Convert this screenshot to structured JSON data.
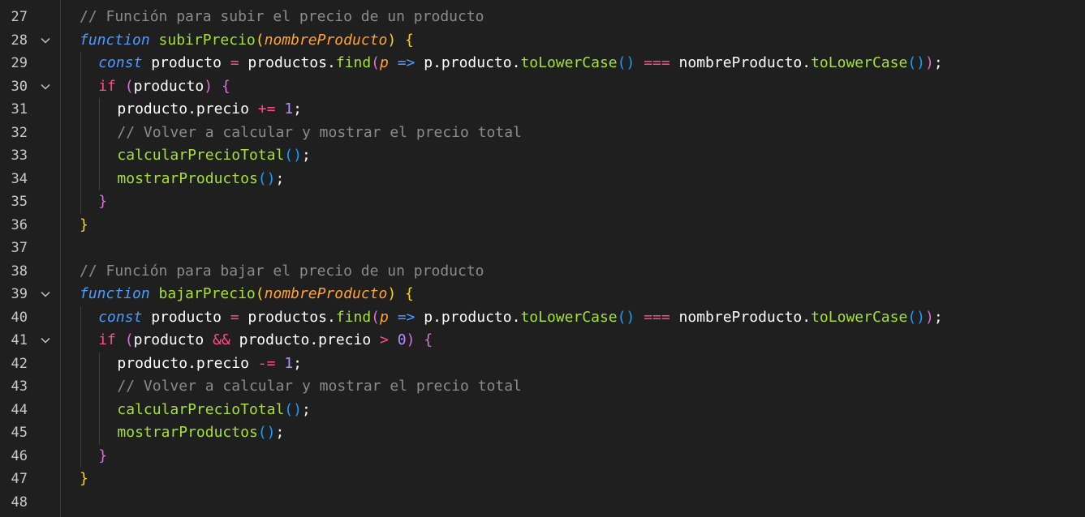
{
  "editor": {
    "lines": [
      {
        "n": "27",
        "fold": false,
        "indent": 0,
        "tokens": [
          {
            "t": "// Función para subir el precio de un producto",
            "c": "t-comment"
          }
        ]
      },
      {
        "n": "28",
        "fold": true,
        "indent": 0,
        "tokens": [
          {
            "t": "function",
            "c": "t-kw-fn"
          },
          {
            "t": " ",
            "c": "t-ident"
          },
          {
            "t": "subirPrecio",
            "c": "t-fnname"
          },
          {
            "t": "(",
            "c": "t-paren-y"
          },
          {
            "t": "nombreProducto",
            "c": "t-param"
          },
          {
            "t": ")",
            "c": "t-paren-y"
          },
          {
            "t": " ",
            "c": "t-ident"
          },
          {
            "t": "{",
            "c": "t-paren-y"
          }
        ]
      },
      {
        "n": "29",
        "fold": false,
        "indent": 1,
        "tokens": [
          {
            "t": "const",
            "c": "t-kw"
          },
          {
            "t": " producto ",
            "c": "t-ident"
          },
          {
            "t": "=",
            "c": "t-op"
          },
          {
            "t": " productos.",
            "c": "t-ident"
          },
          {
            "t": "find",
            "c": "t-method"
          },
          {
            "t": "(",
            "c": "t-paren-p"
          },
          {
            "t": "p",
            "c": "t-param"
          },
          {
            "t": " ",
            "c": "t-ident"
          },
          {
            "t": "=>",
            "c": "t-arrow"
          },
          {
            "t": " p.producto.",
            "c": "t-ident"
          },
          {
            "t": "toLowerCase",
            "c": "t-method"
          },
          {
            "t": "()",
            "c": "t-paren-b"
          },
          {
            "t": " ",
            "c": "t-ident"
          },
          {
            "t": "===",
            "c": "t-op"
          },
          {
            "t": " nombreProducto.",
            "c": "t-ident"
          },
          {
            "t": "toLowerCase",
            "c": "t-method"
          },
          {
            "t": "()",
            "c": "t-paren-b"
          },
          {
            "t": ")",
            "c": "t-paren-p"
          },
          {
            "t": ";",
            "c": "t-ident"
          }
        ]
      },
      {
        "n": "30",
        "fold": true,
        "indent": 1,
        "tokens": [
          {
            "t": "if",
            "c": "t-ctrl"
          },
          {
            "t": " ",
            "c": "t-ident"
          },
          {
            "t": "(",
            "c": "t-paren-p"
          },
          {
            "t": "producto",
            "c": "t-ident"
          },
          {
            "t": ")",
            "c": "t-paren-p"
          },
          {
            "t": " ",
            "c": "t-ident"
          },
          {
            "t": "{",
            "c": "t-paren-p"
          }
        ]
      },
      {
        "n": "31",
        "fold": false,
        "indent": 2,
        "tokens": [
          {
            "t": "producto.precio ",
            "c": "t-ident"
          },
          {
            "t": "+=",
            "c": "t-op"
          },
          {
            "t": " ",
            "c": "t-ident"
          },
          {
            "t": "1",
            "c": "t-num"
          },
          {
            "t": ";",
            "c": "t-ident"
          }
        ]
      },
      {
        "n": "32",
        "fold": false,
        "indent": 2,
        "tokens": [
          {
            "t": "// Volver a calcular y mostrar el precio total",
            "c": "t-comment"
          }
        ]
      },
      {
        "n": "33",
        "fold": false,
        "indent": 2,
        "tokens": [
          {
            "t": "calcularPrecioTotal",
            "c": "t-fnname"
          },
          {
            "t": "()",
            "c": "t-paren-b"
          },
          {
            "t": ";",
            "c": "t-ident"
          }
        ]
      },
      {
        "n": "34",
        "fold": false,
        "indent": 2,
        "tokens": [
          {
            "t": "mostrarProductos",
            "c": "t-fnname"
          },
          {
            "t": "()",
            "c": "t-paren-b"
          },
          {
            "t": ";",
            "c": "t-ident"
          }
        ]
      },
      {
        "n": "35",
        "fold": false,
        "indent": 1,
        "tokens": [
          {
            "t": "}",
            "c": "t-paren-p"
          }
        ]
      },
      {
        "n": "36",
        "fold": false,
        "indent": 0,
        "tokens": [
          {
            "t": "}",
            "c": "t-paren-y"
          }
        ]
      },
      {
        "n": "37",
        "fold": false,
        "indent": 0,
        "tokens": []
      },
      {
        "n": "38",
        "fold": false,
        "indent": 0,
        "tokens": [
          {
            "t": "// Función para bajar el precio de un producto",
            "c": "t-comment"
          }
        ]
      },
      {
        "n": "39",
        "fold": true,
        "indent": 0,
        "tokens": [
          {
            "t": "function",
            "c": "t-kw-fn"
          },
          {
            "t": " ",
            "c": "t-ident"
          },
          {
            "t": "bajarPrecio",
            "c": "t-fnname"
          },
          {
            "t": "(",
            "c": "t-paren-y"
          },
          {
            "t": "nombreProducto",
            "c": "t-param"
          },
          {
            "t": ")",
            "c": "t-paren-y"
          },
          {
            "t": " ",
            "c": "t-ident"
          },
          {
            "t": "{",
            "c": "t-paren-y"
          }
        ]
      },
      {
        "n": "40",
        "fold": false,
        "indent": 1,
        "tokens": [
          {
            "t": "const",
            "c": "t-kw"
          },
          {
            "t": " producto ",
            "c": "t-ident"
          },
          {
            "t": "=",
            "c": "t-op"
          },
          {
            "t": " productos.",
            "c": "t-ident"
          },
          {
            "t": "find",
            "c": "t-method"
          },
          {
            "t": "(",
            "c": "t-paren-p"
          },
          {
            "t": "p",
            "c": "t-param"
          },
          {
            "t": " ",
            "c": "t-ident"
          },
          {
            "t": "=>",
            "c": "t-arrow"
          },
          {
            "t": " p.producto.",
            "c": "t-ident"
          },
          {
            "t": "toLowerCase",
            "c": "t-method"
          },
          {
            "t": "()",
            "c": "t-paren-b"
          },
          {
            "t": " ",
            "c": "t-ident"
          },
          {
            "t": "===",
            "c": "t-op"
          },
          {
            "t": " nombreProducto.",
            "c": "t-ident"
          },
          {
            "t": "toLowerCase",
            "c": "t-method"
          },
          {
            "t": "()",
            "c": "t-paren-b"
          },
          {
            "t": ")",
            "c": "t-paren-p"
          },
          {
            "t": ";",
            "c": "t-ident"
          }
        ]
      },
      {
        "n": "41",
        "fold": true,
        "indent": 1,
        "tokens": [
          {
            "t": "if",
            "c": "t-ctrl"
          },
          {
            "t": " ",
            "c": "t-ident"
          },
          {
            "t": "(",
            "c": "t-paren-p"
          },
          {
            "t": "producto ",
            "c": "t-ident"
          },
          {
            "t": "&&",
            "c": "t-op"
          },
          {
            "t": " producto.precio ",
            "c": "t-ident"
          },
          {
            "t": ">",
            "c": "t-op"
          },
          {
            "t": " ",
            "c": "t-ident"
          },
          {
            "t": "0",
            "c": "t-num"
          },
          {
            "t": ")",
            "c": "t-paren-p"
          },
          {
            "t": " ",
            "c": "t-ident"
          },
          {
            "t": "{",
            "c": "t-paren-p"
          }
        ]
      },
      {
        "n": "42",
        "fold": false,
        "indent": 2,
        "tokens": [
          {
            "t": "producto.precio ",
            "c": "t-ident"
          },
          {
            "t": "-=",
            "c": "t-op"
          },
          {
            "t": " ",
            "c": "t-ident"
          },
          {
            "t": "1",
            "c": "t-num"
          },
          {
            "t": ";",
            "c": "t-ident"
          }
        ]
      },
      {
        "n": "43",
        "fold": false,
        "indent": 2,
        "tokens": [
          {
            "t": "// Volver a calcular y mostrar el precio total",
            "c": "t-comment"
          }
        ]
      },
      {
        "n": "44",
        "fold": false,
        "indent": 2,
        "tokens": [
          {
            "t": "calcularPrecioTotal",
            "c": "t-fnname"
          },
          {
            "t": "()",
            "c": "t-paren-b"
          },
          {
            "t": ";",
            "c": "t-ident"
          }
        ]
      },
      {
        "n": "45",
        "fold": false,
        "indent": 2,
        "tokens": [
          {
            "t": "mostrarProductos",
            "c": "t-fnname"
          },
          {
            "t": "()",
            "c": "t-paren-b"
          },
          {
            "t": ";",
            "c": "t-ident"
          }
        ]
      },
      {
        "n": "46",
        "fold": false,
        "indent": 1,
        "tokens": [
          {
            "t": "}",
            "c": "t-paren-p"
          }
        ]
      },
      {
        "n": "47",
        "fold": false,
        "indent": 0,
        "tokens": [
          {
            "t": "}",
            "c": "t-paren-y"
          }
        ]
      },
      {
        "n": "48",
        "fold": false,
        "indent": 0,
        "tokens": []
      }
    ]
  },
  "icons": {
    "fold": "chevron-down-icon"
  }
}
